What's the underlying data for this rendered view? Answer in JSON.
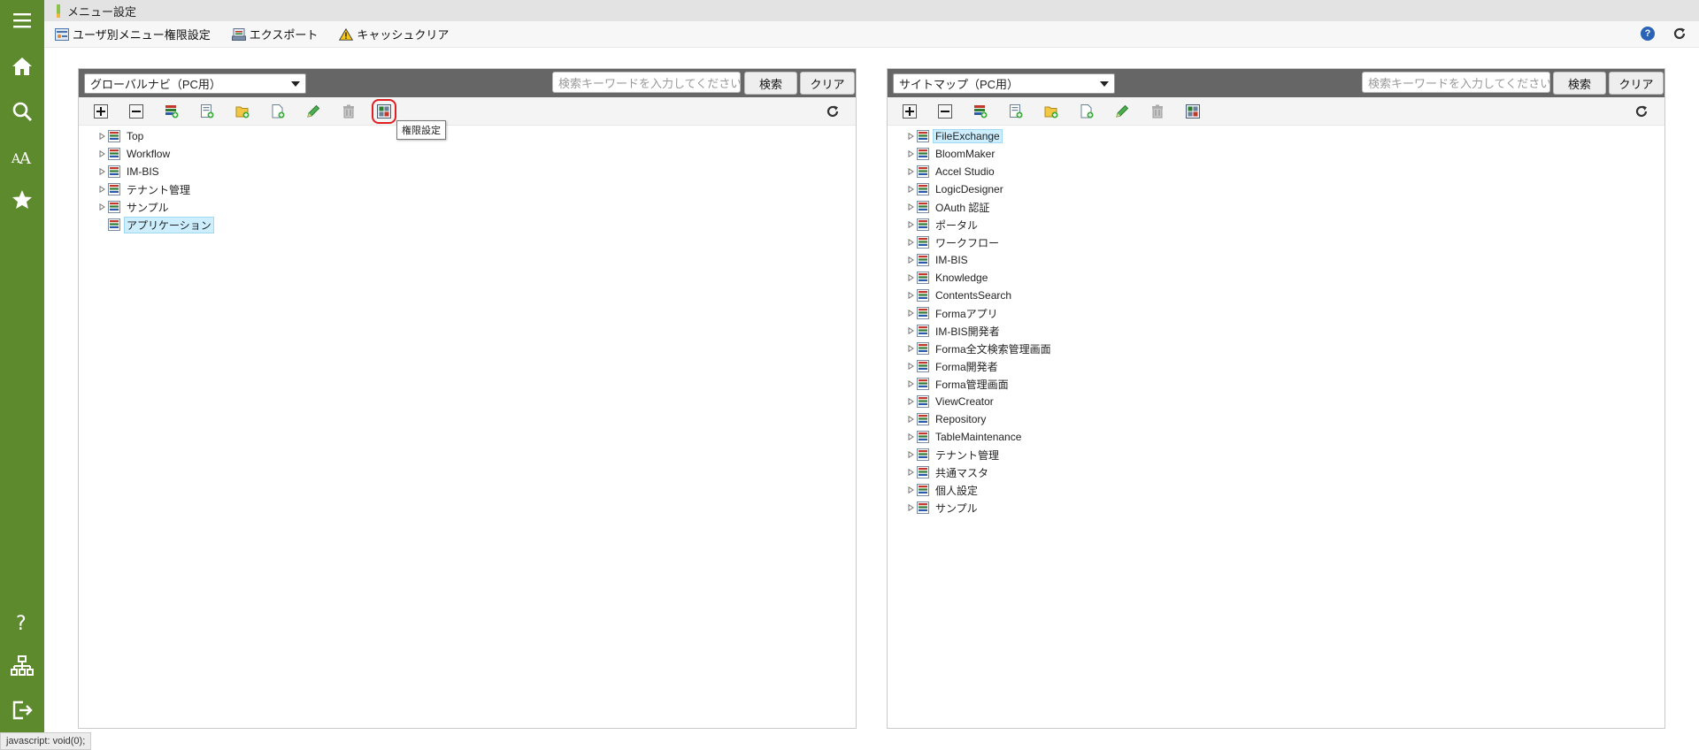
{
  "window": {
    "title": "メニュー設定"
  },
  "colors": {
    "sidebar": "#5e8a2e",
    "panel_header": "#666666",
    "selected_bg": "#cceeff",
    "highlight": "#e02020"
  },
  "sidebar": {
    "top_items": [
      {
        "name": "menu-icon"
      },
      {
        "name": "home-icon"
      },
      {
        "name": "search-icon"
      },
      {
        "name": "font-icon"
      },
      {
        "name": "star-icon"
      }
    ],
    "bottom_items": [
      {
        "name": "help-icon"
      },
      {
        "name": "sitemap-icon"
      },
      {
        "name": "logout-icon"
      }
    ]
  },
  "toolbar": {
    "user_menu_auth": "ユーザ別メニュー権限設定",
    "export": "エクスポート",
    "cache_clear": "キャッシュクリア"
  },
  "left_panel": {
    "select_value": "グローバルナビ（PC用）",
    "search_placeholder": "検索キーワードを入力してください",
    "search_button": "検索",
    "clear_button": "クリア",
    "tooltip": "権限設定",
    "tree": [
      {
        "label": "Top",
        "expandable": true,
        "selected": false
      },
      {
        "label": "Workflow",
        "expandable": true,
        "selected": false
      },
      {
        "label": "IM-BIS",
        "expandable": true,
        "selected": false
      },
      {
        "label": "テナント管理",
        "expandable": true,
        "selected": false
      },
      {
        "label": "サンプル",
        "expandable": true,
        "selected": false
      },
      {
        "label": "アプリケーション",
        "expandable": false,
        "selected": true
      }
    ]
  },
  "right_panel": {
    "select_value": "サイトマップ（PC用）",
    "search_placeholder": "検索キーワードを入力してください",
    "search_button": "検索",
    "clear_button": "クリア",
    "tree": [
      {
        "label": "FileExchange",
        "expandable": true,
        "selected": true
      },
      {
        "label": "BloomMaker",
        "expandable": true,
        "selected": false
      },
      {
        "label": "Accel Studio",
        "expandable": true,
        "selected": false
      },
      {
        "label": "LogicDesigner",
        "expandable": true,
        "selected": false
      },
      {
        "label": "OAuth 認証",
        "expandable": true,
        "selected": false
      },
      {
        "label": "ポータル",
        "expandable": true,
        "selected": false
      },
      {
        "label": "ワークフロー",
        "expandable": true,
        "selected": false
      },
      {
        "label": "IM-BIS",
        "expandable": true,
        "selected": false
      },
      {
        "label": "Knowledge",
        "expandable": true,
        "selected": false
      },
      {
        "label": "ContentsSearch",
        "expandable": true,
        "selected": false
      },
      {
        "label": "Formaアプリ",
        "expandable": true,
        "selected": false
      },
      {
        "label": "IM-BIS開発者",
        "expandable": true,
        "selected": false
      },
      {
        "label": "Forma全文検索管理画面",
        "expandable": true,
        "selected": false
      },
      {
        "label": "Forma開発者",
        "expandable": true,
        "selected": false
      },
      {
        "label": "Forma管理画面",
        "expandable": true,
        "selected": false
      },
      {
        "label": "ViewCreator",
        "expandable": true,
        "selected": false
      },
      {
        "label": "Repository",
        "expandable": true,
        "selected": false
      },
      {
        "label": "TableMaintenance",
        "expandable": true,
        "selected": false
      },
      {
        "label": "テナント管理",
        "expandable": true,
        "selected": false
      },
      {
        "label": "共通マスタ",
        "expandable": true,
        "selected": false
      },
      {
        "label": "個人設定",
        "expandable": true,
        "selected": false
      },
      {
        "label": "サンプル",
        "expandable": true,
        "selected": false
      }
    ]
  },
  "tree_tools": [
    {
      "name": "expand-all-icon"
    },
    {
      "name": "collapse-all-icon"
    },
    {
      "name": "add-menu-group-icon"
    },
    {
      "name": "add-menu-item-icon"
    },
    {
      "name": "add-folder-icon"
    },
    {
      "name": "add-page-icon"
    },
    {
      "name": "edit-icon"
    },
    {
      "name": "delete-icon"
    },
    {
      "name": "authority-settings-icon"
    }
  ],
  "statusbar": {
    "text": "javascript: void(0);"
  }
}
